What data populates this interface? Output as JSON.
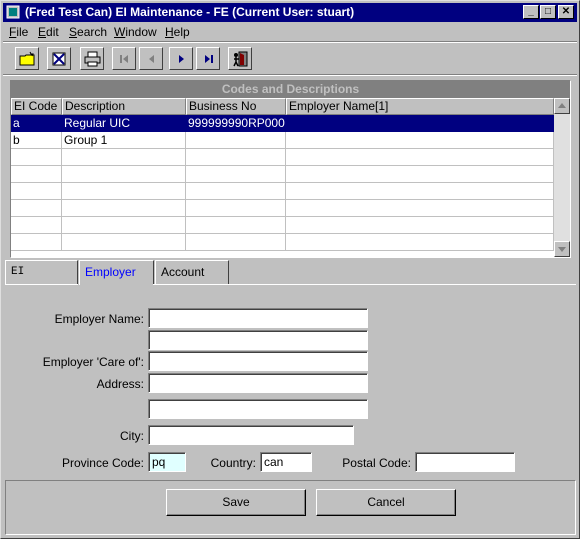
{
  "window": {
    "title": "(Fred Test Can) EI Maintenance - FE (Current User: stuart)",
    "minimize_glyph": "_",
    "maximize_glyph": "□",
    "close_glyph": "✕"
  },
  "menu": {
    "items": [
      "File",
      "Edit",
      "Search",
      "Window",
      "Help"
    ],
    "underlined_letters": [
      "F",
      "E",
      "S",
      "W",
      "H"
    ]
  },
  "toolbar": {
    "buttons": [
      "new-record-icon",
      "delete-record-icon",
      "print-icon",
      "first-record-icon",
      "previous-record-icon",
      "next-record-icon",
      "last-record-icon",
      "exit-icon"
    ]
  },
  "grid": {
    "caption": "Codes and Descriptions",
    "columns": [
      "EI Code",
      "Description",
      "Business No",
      "Employer Name[1]"
    ],
    "rows": [
      [
        "a",
        "Regular UIC",
        "999999990RP000",
        ""
      ],
      [
        "b",
        "Group 1",
        "",
        ""
      ]
    ],
    "selected_row": 0,
    "empty_rows": 6
  },
  "tabs": {
    "items": [
      "EI",
      "Employer",
      "Account"
    ],
    "active": "Employer"
  },
  "form": {
    "employer_name_label": "Employer Name:",
    "employer_name_line1": "",
    "employer_name_line2": "",
    "care_of_label": "Employer 'Care of':",
    "care_of_value": "",
    "address_label": "Address:",
    "address_line1": "",
    "address_line2": "",
    "city_label": "City:",
    "city_value": "",
    "province_label": "Province Code:",
    "province_value": "pq",
    "country_label": "Country:",
    "country_value": "can",
    "postal_label": "Postal Code:",
    "postal_value": ""
  },
  "buttons": {
    "save": "Save",
    "cancel": "Cancel"
  },
  "colors": {
    "title_bar": "#000080",
    "selection": "#000080",
    "active_tab_text": "#0000ff",
    "province_field": "#e0ffff"
  }
}
